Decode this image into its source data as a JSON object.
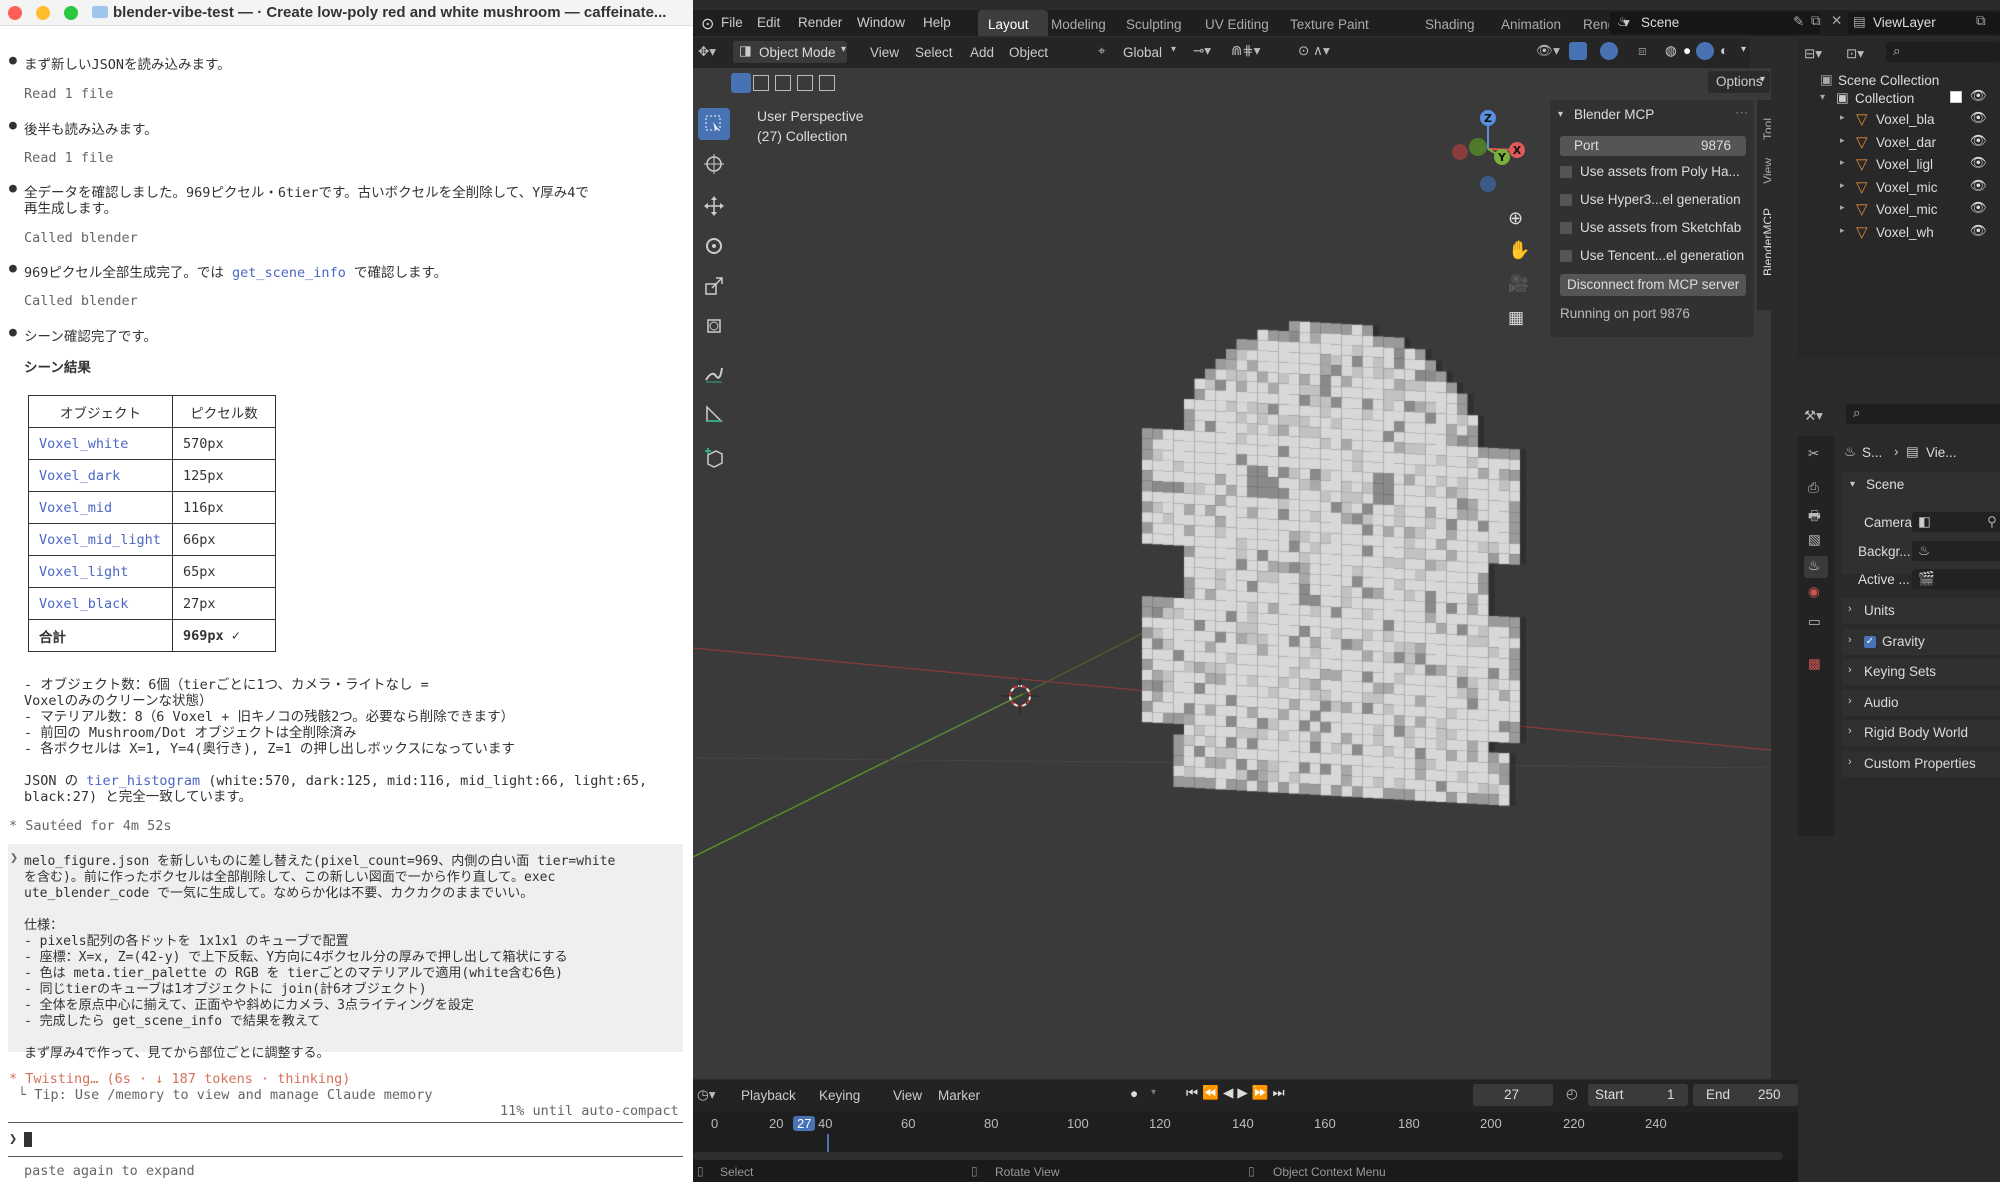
{
  "terminal": {
    "title": "blender-vibe-test — ·  Create low-poly red and white mushroom — caffeinate...",
    "lines": [
      "まず新しいJSONを読み込みます。",
      "Read 1 file",
      "後半も読み込みます。",
      "Read 1 file",
      "全データを確認しました。969ピクセル・6tierです。古いボクセルを全削除して、Y厚み4で",
      "再生成します。",
      "Called blender",
      "969ピクセル全部生成完了。では",
      "get_scene_info",
      "で確認します。",
      "Called blender",
      "シーン確認完了です。",
      "シーン結果"
    ],
    "table": {
      "headers": [
        "オブジェクト",
        "ピクセル数"
      ],
      "rows": [
        [
          "Voxel_white",
          "570px"
        ],
        [
          "Voxel_dark",
          "125px"
        ],
        [
          "Voxel_mid",
          "116px"
        ],
        [
          "Voxel_mid_light",
          "66px"
        ],
        [
          "Voxel_light",
          "65px"
        ],
        [
          "Voxel_black",
          "27px"
        ]
      ],
      "total_label": "合計",
      "total_value": "969px ✓"
    },
    "summary": [
      "- オブジェクト数：6個（tierごとに1つ、カメラ・ライトなし =",
      "Voxelのみのクリーンな状態）",
      "- マテリアル数：8（6 Voxel + 旧キノコの残骸2つ。必要なら削除できます）",
      "- 前回の Mushroom/Dot オブジェクトは全削除済み",
      "- 各ボクセルは X=1, Y=4(奥行き), Z=1 の押し出しボックスになっています"
    ],
    "json_line1_a": "JSON の",
    "json_line1_b": "tier_histogram",
    "json_line1_c": "(white:570, dark:125, mid:116, mid_light:66, light:65,",
    "json_line2": "black:27) と完全一致しています。",
    "sauteed": "* Sautéed for 4m 52s",
    "prompt": [
      "melo_figure.json を新しいものに差し替えた(pixel_count=969、内側の白い面 tier=white",
      "を含む)。前に作ったボクセルは全部削除して、この新しい図面で一から作り直して。exec",
      "ute_blender_code で一気に生成して。なめらか化は不要、カクカクのままでいい。",
      "",
      "仕様：",
      "- pixels配列の各ドットを 1x1x1 のキューブで配置",
      "- 座標：X=x, Z=(42-y) で上下反転、Y方向に4ボクセル分の厚みで押し出して箱状にする",
      "- 色は meta.tier_palette の RGB を tierごとのマテリアルで適用(white含む6色)",
      "- 同じtierのキューブは1オブジェクトに join(計6オブジェクト)",
      "- 全体を原点中心に揃えて、正面やや斜めにカメラ、3点ライティングを設定",
      "- 完成したら get_scene_info で結果を教えて",
      "",
      "まず厚み4で作って、見てから部位ごとに調整する。"
    ],
    "twisting": "* Twisting… (6s · ↓ 187 tokens · thinking)",
    "tip": "└ Tip: Use /memory to view and manage Claude memory",
    "autocompact": "11% until auto-compact",
    "input_prompt": "❯",
    "paste_hint": "paste again to expand"
  },
  "blender": {
    "menus": [
      "File",
      "Edit",
      "Render",
      "Window",
      "Help"
    ],
    "workspaces": [
      "Layout",
      "Modeling",
      "Sculpting",
      "UV Editing",
      "Texture Paint",
      "Shading",
      "Animation",
      "Rend"
    ],
    "scene_name": "Scene",
    "viewlayer_name": "ViewLayer",
    "mode": "Object Mode",
    "vp_menus": [
      "View",
      "Select",
      "Add",
      "Object"
    ],
    "transform": "Global",
    "options": "Options",
    "perspective": "User Perspective",
    "collection_info": "(27) Collection",
    "npanel": {
      "title": "Blender MCP",
      "port_label": "Port",
      "port_value": "9876",
      "checks": [
        "Use assets from Poly Ha...",
        "Use Hyper3...el generation",
        "Use assets from Sketchfab",
        "Use Tencent...el generation"
      ],
      "disconnect": "Disconnect from MCP server",
      "running": "Running on port 9876"
    },
    "side_tabs": [
      "Tool",
      "View",
      "BlenderMCP"
    ],
    "outliner": {
      "scene_collection": "Scene Collection",
      "collection": "Collection",
      "items": [
        "Voxel_bla",
        "Voxel_dar",
        "Voxel_ligl",
        "Voxel_mic",
        "Voxel_mic",
        "Voxel_wh"
      ]
    },
    "properties": {
      "breadcrumb_a": "S...",
      "breadcrumb_b": "Vie...",
      "scene_header": "Scene",
      "camera": "Camera",
      "background": "Backgr...",
      "active": "Active ...",
      "sections": [
        "Units",
        "Gravity",
        "Keying Sets",
        "Audio",
        "Rigid Body World",
        "Custom Properties"
      ]
    },
    "timeline": {
      "menus": [
        "Playback",
        "Keying",
        "View",
        "Marker"
      ],
      "current_frame": "27",
      "start_label": "Start",
      "start": "1",
      "end_label": "End",
      "end": "250",
      "ticks": [
        "0",
        "20",
        "27",
        "40",
        "60",
        "80",
        "100",
        "120",
        "140",
        "160",
        "180",
        "200",
        "220",
        "240"
      ]
    },
    "status": [
      "Select",
      "Rotate View",
      "Object Context Menu"
    ],
    "axes": {
      "x": "X",
      "y": "Y",
      "z": "Z"
    }
  }
}
